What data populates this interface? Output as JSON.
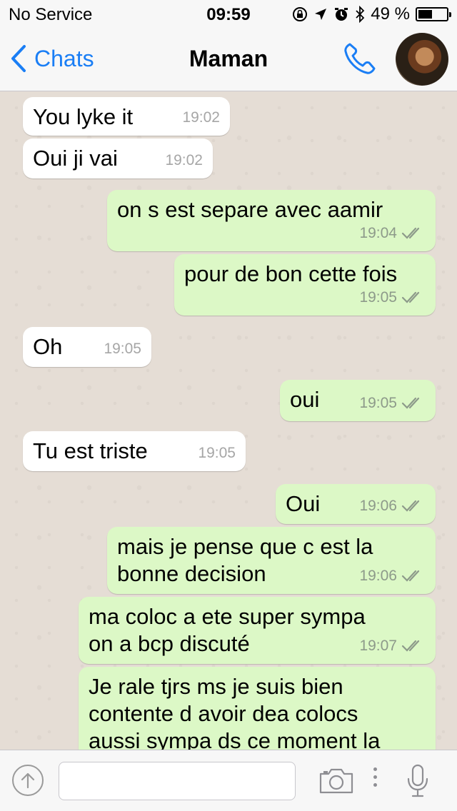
{
  "status_bar": {
    "carrier": "No Service",
    "time": "09:59",
    "battery_text": "49 %",
    "battery_level": 0.49
  },
  "header": {
    "back_label": "Chats",
    "title": "Maman"
  },
  "messages": [
    {
      "text": [
        "You lyke it"
      ],
      "time": "19:02",
      "direction": "incoming"
    },
    {
      "text": [
        "Oui ji vai"
      ],
      "time": "19:02",
      "direction": "incoming"
    },
    {
      "text": [
        "on s est separe avec aamir"
      ],
      "time": "19:04",
      "direction": "outgoing",
      "status": "read"
    },
    {
      "text": [
        "pour de bon cette fois"
      ],
      "time": "19:05",
      "direction": "outgoing",
      "status": "read"
    },
    {
      "text": [
        "Oh"
      ],
      "time": "19:05",
      "direction": "incoming"
    },
    {
      "text": [
        "oui"
      ],
      "time": "19:05",
      "direction": "outgoing",
      "status": "read"
    },
    {
      "text": [
        "Tu est triste"
      ],
      "time": "19:05",
      "direction": "incoming"
    },
    {
      "text": [
        "Oui"
      ],
      "time": "19:06",
      "direction": "outgoing",
      "status": "read"
    },
    {
      "text": [
        "mais je pense que c est la",
        "bonne decision"
      ],
      "time": "19:06",
      "direction": "outgoing",
      "status": "read"
    },
    {
      "text": [
        "ma coloc a ete super sympa",
        "on a bcp discuté"
      ],
      "time": "19:07",
      "direction": "outgoing",
      "status": "read"
    },
    {
      "text": [
        "Je rale tjrs ms je suis bien",
        "contente d avoir dea colocs",
        "aussi sympa ds ce moment la"
      ],
      "time": "",
      "direction": "outgoing",
      "status": "read"
    }
  ],
  "input": {
    "value": "",
    "placeholder": ""
  },
  "colors": {
    "accent": "#1a7ef5",
    "outgoing_bubble": "#dcf8c6",
    "incoming_bubble": "#ffffff",
    "chat_background": "#e5ddd5",
    "tick_color": "#8d9a8a"
  },
  "icons": [
    "back-chevron-icon",
    "phone-icon",
    "avatar",
    "location-arrow-icon",
    "alarm-icon",
    "bluetooth-icon",
    "orientation-lock-icon",
    "upload-arrow-icon",
    "camera-icon",
    "more-dots-icon",
    "microphone-icon",
    "double-check-icon"
  ]
}
